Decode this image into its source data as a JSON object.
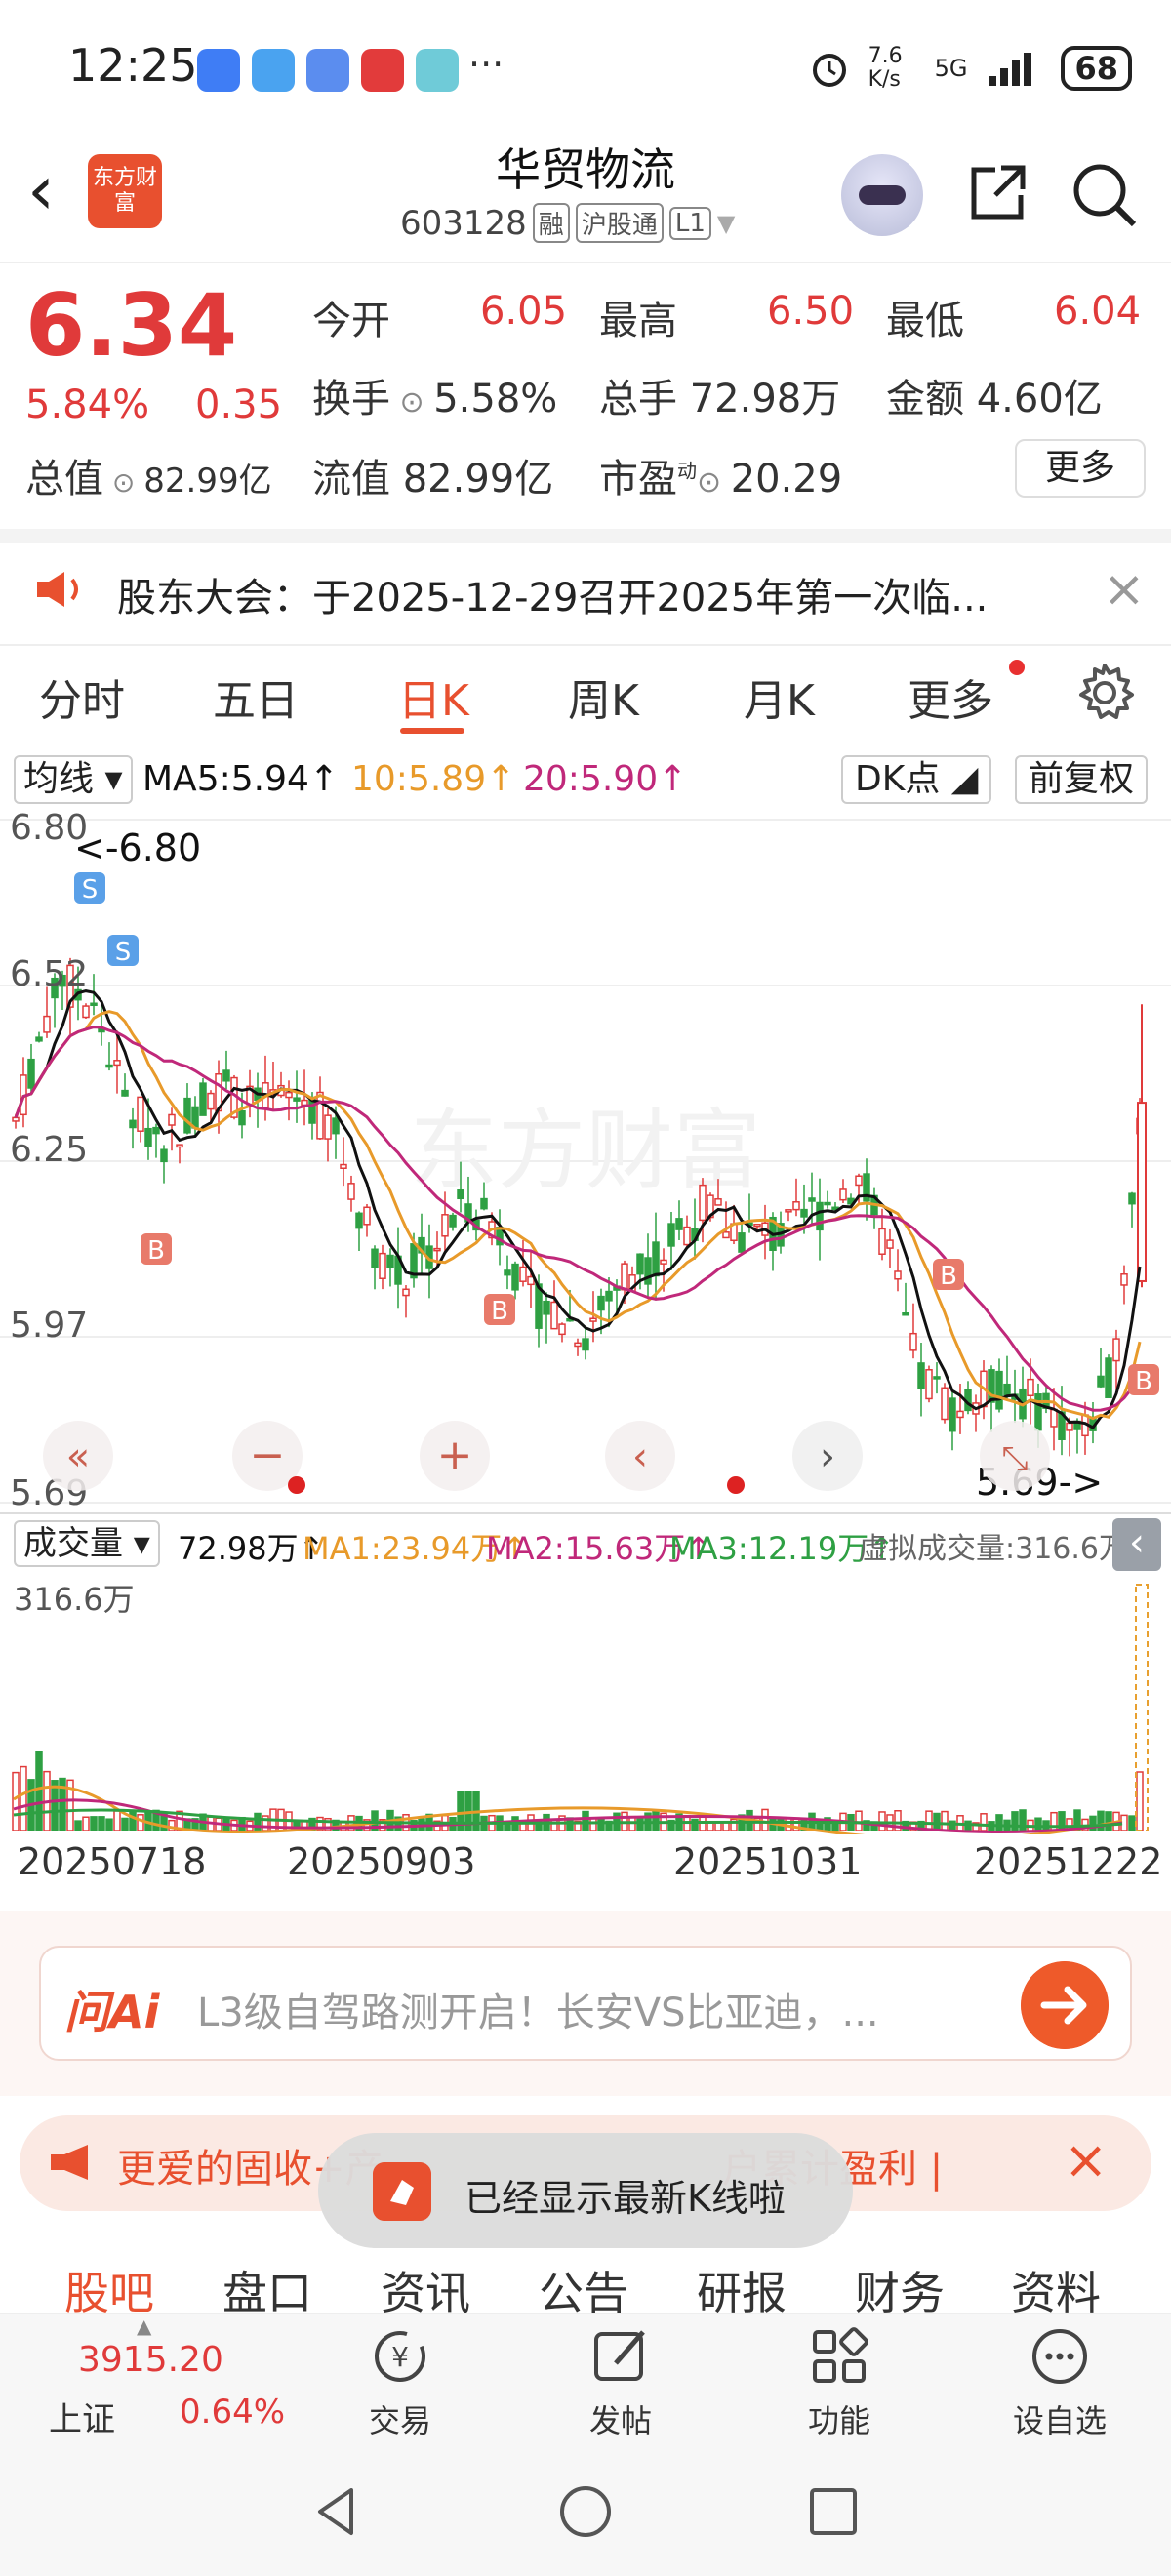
{
  "status_bar": {
    "time": "12:25",
    "more": "···",
    "net_speed": "7.6 K/s",
    "signal": "5G",
    "battery": "68"
  },
  "header": {
    "stock_name": "华贸物流",
    "stock_code": "603128",
    "tags": [
      "融",
      "沪股通",
      "L1"
    ],
    "logo_text": "东方财富"
  },
  "quote": {
    "price": "6.34",
    "change_pct": "5.84%",
    "change_amt": "0.35",
    "open_label": "今开",
    "open": "6.05",
    "high_label": "最高",
    "high": "6.50",
    "low_label": "最低",
    "low": "6.04",
    "turnover_label": "换手",
    "turnover": "5.58%",
    "volume_label": "总手",
    "volume": "72.98万",
    "amount_label": "金额",
    "amount": "4.60亿",
    "mktcap_label": "总值",
    "mktcap": "82.99亿",
    "float_label": "流值",
    "float": "82.99亿",
    "pe_label": "市盈",
    "pe_sup": "动",
    "pe": "20.29",
    "more_label": "更多"
  },
  "notice": {
    "text": "股东大会：于2025-12-29召开2025年第一次临..."
  },
  "period_tabs": [
    "分时",
    "五日",
    "日K",
    "周K",
    "月K",
    "更多"
  ],
  "indicator": {
    "select": "均线",
    "ma5": "MA5:5.94↑",
    "ma10": "10:5.89↑",
    "ma20": "20:5.90↑",
    "dk": "DK点",
    "adjust": "前复权"
  },
  "kline": {
    "y_ticks": [
      "6.80",
      "6.52",
      "6.25",
      "5.97",
      "5.69"
    ],
    "max_label": "<-6.80",
    "min_label": "5.69->",
    "watermark": "东方财富"
  },
  "volume": {
    "select": "成交量",
    "vol": "72.98万↑",
    "ma1": "MA1:23.94万↑",
    "ma2": "MA2:15.63万↑",
    "ma3": "MA3:12.19万↑",
    "virtual": "虚拟成交量:316.6万",
    "top_label": "316.6万"
  },
  "x_labels": [
    "20250718",
    "20250903",
    "20251031",
    "20251222"
  ],
  "ai": {
    "logo": "问Ai",
    "placeholder": "L3级自驾路测开启！长安VS比亚迪，..."
  },
  "ad": {
    "left": "更爱的固收+产",
    "right": "户累计盈利 |"
  },
  "toast": {
    "text": "已经显示最新K线啦"
  },
  "bottom_tabs": [
    "股吧",
    "盘口",
    "资讯",
    "公告",
    "研报",
    "财务",
    "资料"
  ],
  "footer": {
    "index_value": "3915.20",
    "index_name": "上证",
    "index_pct": "0.64%",
    "tools": [
      "交易",
      "发帖",
      "功能",
      "设自选"
    ]
  },
  "colors": {
    "up": "#e03a3a",
    "down": "#2ea043",
    "accent": "#e8502f",
    "ma5": "#111111",
    "ma10": "#e89a2a",
    "ma20": "#c0287a"
  }
}
